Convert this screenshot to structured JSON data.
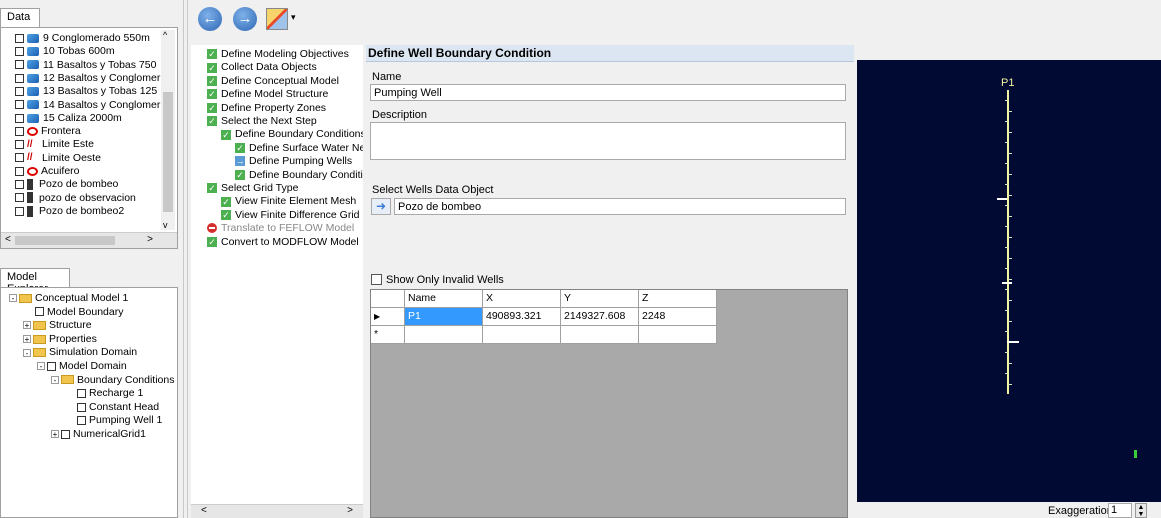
{
  "data_panel": {
    "tab_label": "Data",
    "items": [
      {
        "label": "9 Conglomerado 550m",
        "type": "layer"
      },
      {
        "label": "10 Tobas 600m",
        "type": "layer"
      },
      {
        "label": "11 Basaltos y Tobas 750",
        "type": "layer"
      },
      {
        "label": "12 Basaltos y Conglomer",
        "type": "layer"
      },
      {
        "label": "13 Basaltos y Tobas 125",
        "type": "layer"
      },
      {
        "label": "14 Basaltos y Conglomer",
        "type": "layer"
      },
      {
        "label": "15 Caliza 2000m",
        "type": "layer"
      },
      {
        "label": "Frontera",
        "type": "polygon"
      },
      {
        "label": "Limite Este",
        "type": "line"
      },
      {
        "label": "Limite Oeste",
        "type": "line"
      },
      {
        "label": "Acuifero",
        "type": "polygon"
      },
      {
        "label": "Pozo de bombeo",
        "type": "well"
      },
      {
        "label": "pozo de observacion",
        "type": "well"
      },
      {
        "label": "Pozo de bombeo2",
        "type": "well"
      }
    ]
  },
  "model_explorer": {
    "tab_label": "Model Explorer",
    "items": [
      {
        "label": "Conceptual Model 1",
        "kind": "folder",
        "level": 0,
        "exp": "-"
      },
      {
        "label": "Model Boundary",
        "kind": "check",
        "level": 1,
        "exp": ""
      },
      {
        "label": "Structure",
        "kind": "folder",
        "level": 1,
        "exp": "+"
      },
      {
        "label": "Properties",
        "kind": "folder",
        "level": 1,
        "exp": "+"
      },
      {
        "label": "Simulation Domain",
        "kind": "folder",
        "level": 1,
        "exp": "-"
      },
      {
        "label": "Model Domain",
        "kind": "check",
        "level": 2,
        "exp": "-"
      },
      {
        "label": "Boundary Conditions",
        "kind": "folder",
        "level": 3,
        "exp": "-"
      },
      {
        "label": "Recharge  1",
        "kind": "check",
        "level": 4,
        "exp": ""
      },
      {
        "label": "Constant Head",
        "kind": "check",
        "level": 4,
        "exp": ""
      },
      {
        "label": "Pumping Well 1",
        "kind": "check",
        "level": 4,
        "exp": ""
      },
      {
        "label": "NumericalGrid1",
        "kind": "check",
        "level": 3,
        "exp": "+"
      }
    ]
  },
  "workflow": {
    "items": [
      {
        "label": "Define Modeling Objectives",
        "icon": "ok",
        "level": 0
      },
      {
        "label": "Collect Data Objects",
        "icon": "ok",
        "level": 0
      },
      {
        "label": "Define  Conceptual Model",
        "icon": "ok",
        "level": 0
      },
      {
        "label": "Define  Model Structure",
        "icon": "ok",
        "level": 0
      },
      {
        "label": "Define  Property Zones",
        "icon": "ok",
        "level": 0
      },
      {
        "label": "Select the Next Step",
        "icon": "ok",
        "level": 0
      },
      {
        "label": "Define Boundary Conditions",
        "icon": "ok",
        "level": 1
      },
      {
        "label": "Define Surface Water Ne",
        "icon": "ok",
        "level": 2
      },
      {
        "label": "Define Pumping Wells",
        "icon": "arrow",
        "level": 2
      },
      {
        "label": "Define Boundary Conditic",
        "icon": "ok",
        "level": 2
      },
      {
        "label": "Select Grid Type",
        "icon": "ok",
        "level": 0
      },
      {
        "label": "View Finite Element Mesh",
        "icon": "ok",
        "level": 1
      },
      {
        "label": "View Finite Difference Grid",
        "icon": "ok",
        "level": 1
      },
      {
        "label": "Translate to FEFLOW Model",
        "icon": "stop",
        "level": 0
      },
      {
        "label": "Convert to MODFLOW Model",
        "icon": "ok",
        "level": 0
      }
    ]
  },
  "form": {
    "title": "Define Well Boundary Condition",
    "name_label": "Name",
    "name_value": "Pumping Well",
    "description_label": "Description",
    "description_value": "",
    "select_label": "Select Wells Data Object",
    "select_value": "Pozo de bombeo",
    "show_invalid_label": "Show Only Invalid Wells",
    "grid": {
      "columns": [
        "Name",
        "X",
        "Y",
        "Z"
      ],
      "rows": [
        [
          "P1",
          "490893.321",
          "2149327.608",
          "2248"
        ]
      ]
    }
  },
  "viewer": {
    "well_label": "P1",
    "exaggeration_label": "Exaggeration",
    "exaggeration_value": "1",
    "background": "#000a33",
    "well_color": "#f4f4a0"
  }
}
